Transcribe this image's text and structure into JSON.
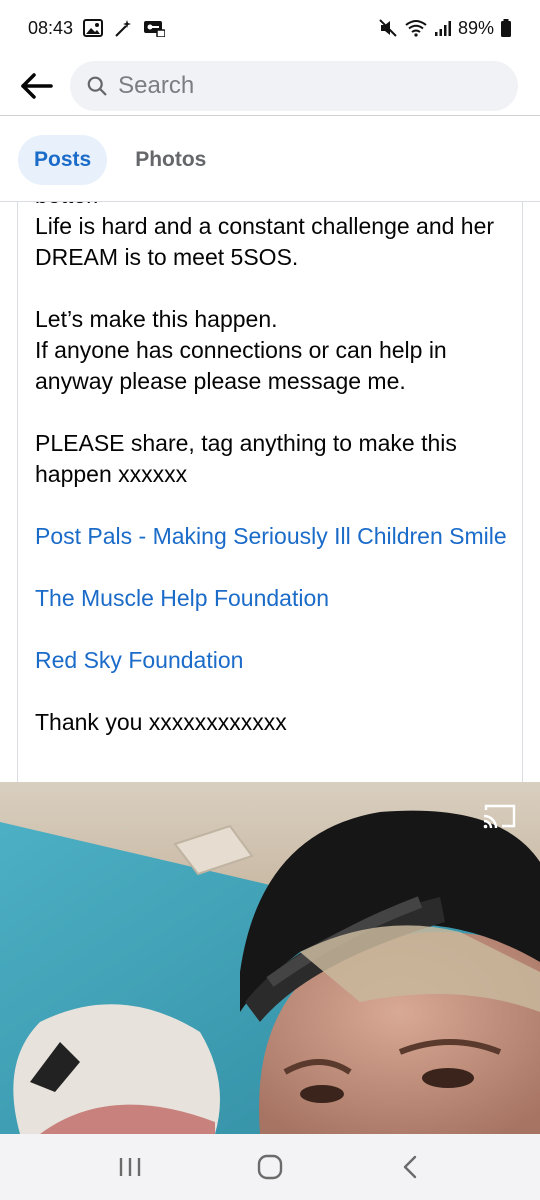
{
  "status_bar": {
    "time": "08:43",
    "battery": "89%"
  },
  "search": {
    "placeholder": "Search"
  },
  "tabs": [
    {
      "label": "Posts",
      "active": true
    },
    {
      "label": "Photos",
      "active": false
    }
  ],
  "post": {
    "clipped_line": "better.",
    "paragraph_1": "Life is hard and a constant challenge and her DREAM is to meet 5SOS.",
    "paragraph_2_line_1": "Let’s make this happen.",
    "paragraph_2_line_2": "If anyone has connections or can help in anyway please please message me.",
    "paragraph_3": "PLEASE share, tag anything to make this happen xxxxxx",
    "links": [
      "Post Pals - Making Seriously Ill Children Smile",
      "The Muscle Help Foundation",
      "Red Sky Foundation"
    ],
    "closing": "Thank you xxxxxxxxxxxx"
  },
  "colors": {
    "link": "#1b6bc9",
    "tab_active_bg": "#e7f0fb",
    "search_bg": "#f0f2f5"
  },
  "icons": {
    "back": "arrow-left-icon",
    "search": "search-icon",
    "cast": "cast-icon",
    "nav_recents": "recents-icon",
    "nav_home": "home-icon",
    "nav_back": "chevron-left-icon"
  }
}
